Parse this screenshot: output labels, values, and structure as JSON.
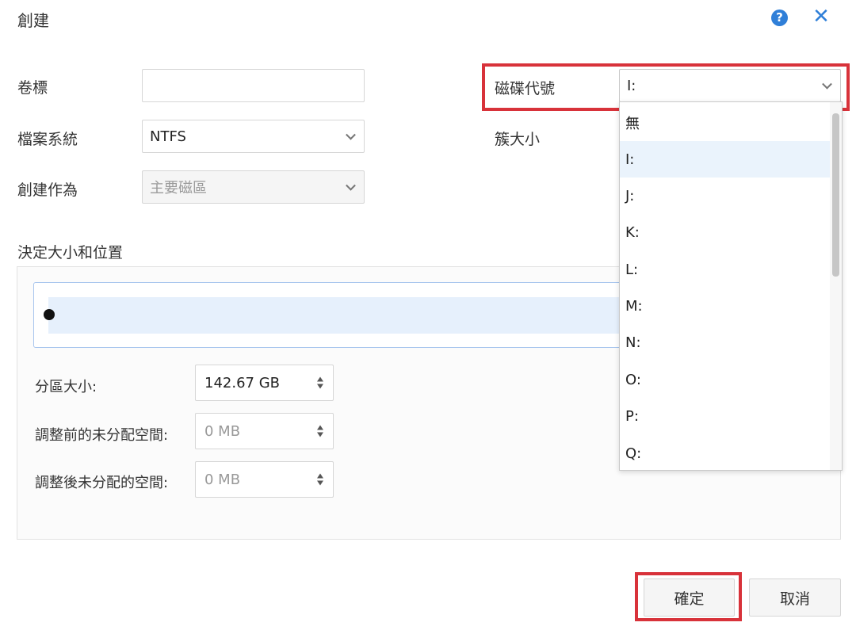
{
  "dialog": {
    "title": "創建",
    "help_icon_glyph": "?",
    "close_icon_glyph": "✕",
    "accent_color": "#2f7fd8",
    "highlight_color": "#d8323a"
  },
  "form": {
    "volume_label": {
      "label": "卷標",
      "value": ""
    },
    "file_system": {
      "label": "檔案系統",
      "value": "NTFS"
    },
    "create_as": {
      "label": "創建作為",
      "value": "主要磁區"
    },
    "drive_letter": {
      "label": "磁碟代號",
      "value": "I:"
    },
    "cluster_size": {
      "label": "簇大小"
    }
  },
  "size_section": {
    "title": "決定大小和位置",
    "partition_size": {
      "label": "分區大小:",
      "value": "142.67 GB"
    },
    "unallocated_before": {
      "label": "調整前的未分配空間:",
      "value": "0 MB"
    },
    "unallocated_after": {
      "label": "調整後未分配的空間:",
      "value": "0 MB"
    }
  },
  "drive_dropdown": {
    "options": [
      "無",
      "I:",
      "J:",
      "K:",
      "L:",
      "M:",
      "N:",
      "O:",
      "P:",
      "Q:"
    ],
    "selected": "I:"
  },
  "buttons": {
    "ok": "確定",
    "cancel": "取消"
  }
}
